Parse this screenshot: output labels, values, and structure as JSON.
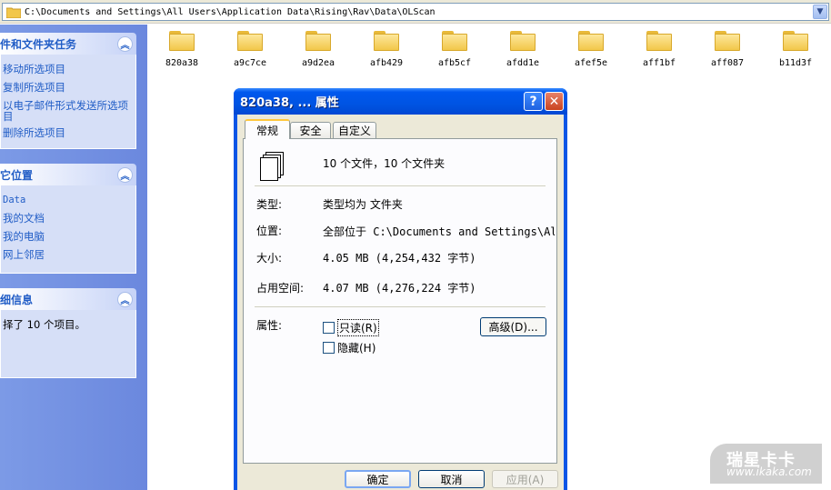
{
  "address_bar": {
    "path": "C:\\Documents and Settings\\All Users\\Application Data\\Rising\\Rav\\Data\\OLScan",
    "dropdown_icon": "chevron-down-icon"
  },
  "task_pane": {
    "file_tasks": {
      "title": "件和文件夹任务",
      "items": [
        "移动所选项目",
        "复制所选项目",
        "以电子邮件形式发送所选项目",
        "删除所选项目"
      ]
    },
    "other_places": {
      "title": "它位置",
      "items": [
        "Data",
        "我的文档",
        "我的电脑",
        "网上邻居"
      ]
    },
    "details": {
      "title": "细信息",
      "text": "择了 10 个项目。"
    }
  },
  "folders": [
    "820a38",
    "a9c7ce",
    "a9d2ea",
    "afb429",
    "afb5cf",
    "afdd1e",
    "afef5e",
    "aff1bf",
    "aff087",
    "b11d3f"
  ],
  "dialog": {
    "title": "820a38, ... 属性",
    "help_label": "?",
    "close_label": "✕",
    "tabs": [
      "常规",
      "安全",
      "自定义"
    ],
    "summary": "10 个文件，10 个文件夹",
    "type_label": "类型:",
    "type_value": "类型均为 文件夹",
    "location_label": "位置:",
    "location_value": "全部位于 C:\\Documents and Settings\\All Us",
    "size_label": "大小:",
    "size_value": "4.05 MB (4,254,432 字节)",
    "disk_label": "占用空间:",
    "disk_value": "4.07 MB (4,276,224 字节)",
    "attributes_label": "属性:",
    "readonly_label": "只读(R)",
    "hidden_label": "隐藏(H)",
    "advanced_label": "高级(D)...",
    "ok_label": "确定",
    "cancel_label": "取消",
    "apply_label": "应用(A)"
  },
  "watermark": {
    "logo": "瑞星卡卡",
    "url": "www.ikaka.com"
  }
}
